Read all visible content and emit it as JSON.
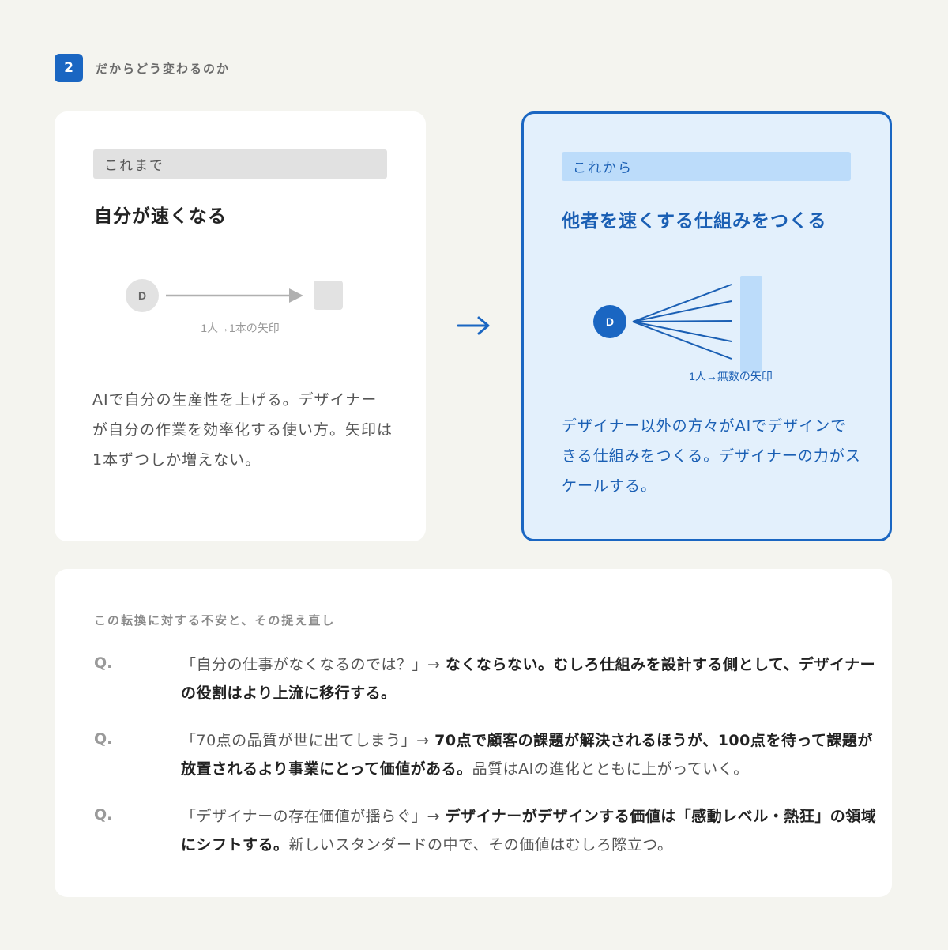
{
  "header": {
    "number": "2",
    "title": "だからどう変わるのか"
  },
  "before": {
    "tag": "これまで",
    "title": "自分が速くなる",
    "node_label": "D",
    "caption": "1人→1本の矢印",
    "description": "AIで自分の生産性を上げる。デザイナーが自分の作業を効率化する使い方。矢印は1本ずつしか増えない。"
  },
  "transition_arrow": "→",
  "after": {
    "tag": "これから",
    "title": "他者を速くする仕組みをつくる",
    "node_label": "D",
    "caption": "1人→無数の矢印",
    "description": "デザイナー以外の方々がAIでデザインできる仕組みをつくる。デザイナーの力がスケールする。"
  },
  "faq": {
    "heading": "この転換に対する不安と、その捉え直し",
    "items": [
      {
        "q": "Q.",
        "question": "「自分の仕事がなくなるのでは？」→ ",
        "answer_bold": "なくならない。むしろ仕組みを設計する側として、デザイナーの役割はより上流に移行する。",
        "answer_rest": ""
      },
      {
        "q": "Q.",
        "question": "「70点の品質が世に出てしまう」→ ",
        "answer_bold": "70点で顧客の課題が解決されるほうが、100点を待って課題が放置されるより事業にとって価値がある。",
        "answer_rest": "品質はAIの進化とともに上がっていく。"
      },
      {
        "q": "Q.",
        "question": "「デザイナーの存在価値が揺らぐ」→ ",
        "answer_bold": "デザイナーがデザインする価値は「感動レベル・熱狂」の領域にシフトする。",
        "answer_rest": "新しいスタンダードの中で、その価値はむしろ際立つ。"
      }
    ]
  },
  "colors": {
    "accent": "#1a66c2",
    "accent_light": "#e3f0fc",
    "muted": "#9a9a9a"
  }
}
